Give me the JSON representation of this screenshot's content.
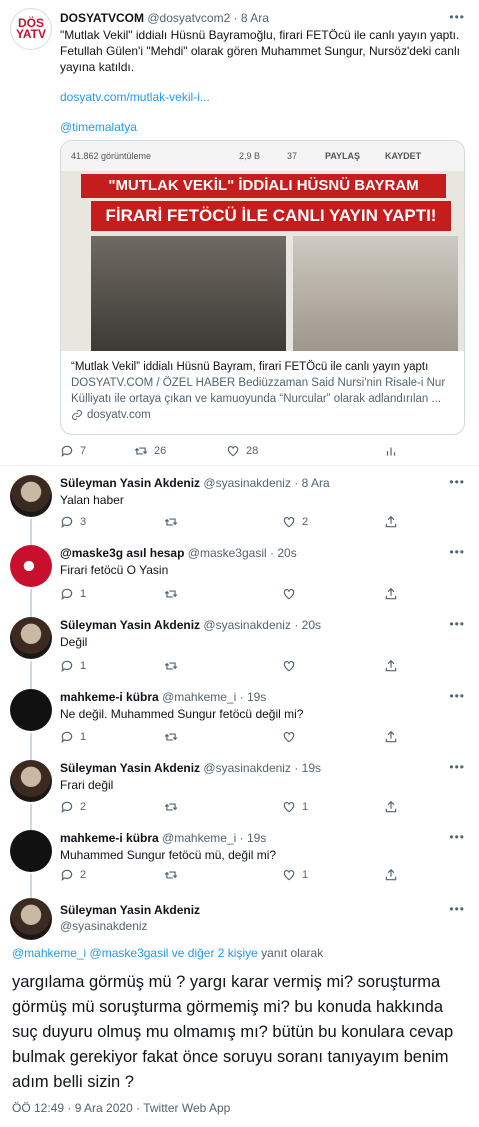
{
  "main_tweet": {
    "avatar_text": [
      "DÖS",
      "YATV"
    ],
    "name": "DOSYATVCOM",
    "handle": "@dosyatvcom2",
    "date": "· 8 Ara",
    "text": "\"Mutlak Vekil\" iddialı Hüsnü Bayramoğlu, firari FETÖcü ile canlı yayın yaptı. Fetullah Gülen'i \"Mehdi\" olarak gören Muhammet Sungur, Nursöz'deki canlı yayına katıldı.",
    "link": "dosyatv.com/mutlak-vekil-i...",
    "mention": "@timemalatya",
    "card": {
      "views": "41.862 görüntüleme",
      "likes": "2,9 B",
      "dislikes": "37",
      "share": "PAYLAŞ",
      "save": "KAYDET",
      "banner1": "\"MUTLAK VEKİL\" İDDİALI HÜSNÜ BAYRAM",
      "banner2": "FİRARİ FETÖCÜ İLE CANLI YAYIN YAPTI!",
      "title": "“Mutlak Vekil” iddialı Hüsnü Bayram, firari FETÖcü ile canlı yayın yaptı",
      "description": "DOSYATV.COM / ÖZEL HABER Bediüzzaman Said Nursi'nin Risale-i Nur Külliyatı ile ortaya çıkan ve kamuoyunda “Nurcular” olarak adlandırılan ...",
      "domain": "dosyatv.com"
    },
    "replies": "7",
    "retweets": "26",
    "likes": "28"
  },
  "replies": [
    {
      "name": "Süleyman Yasin Akdeniz",
      "handle": "@syasinakdeniz",
      "date": "· 8 Ara",
      "text": "Yalan haber",
      "replies": "3",
      "retweets": "",
      "likes": "2"
    },
    {
      "name": "@maske3g asıl hesap",
      "handle": "@maske3gasil",
      "date": "· 20s",
      "text": "Firari fetöcü O Yasin",
      "replies": "1",
      "retweets": "",
      "likes": ""
    },
    {
      "name": "Süleyman Yasin Akdeniz",
      "handle": "@syasinakdeniz",
      "date": "· 20s",
      "text": "Değil",
      "replies": "1",
      "retweets": "",
      "likes": ""
    },
    {
      "name": "mahkeme-i kübra",
      "handle": "@mahkeme_i",
      "date": "· 19s",
      "text": "Ne değil. Muhammed Sungur fetöcü değil mi?",
      "replies": "1",
      "retweets": "",
      "likes": ""
    },
    {
      "name": "Süleyman Yasin Akdeniz",
      "handle": "@syasinakdeniz",
      "date": "· 19s",
      "text": "Frari değil",
      "replies": "2",
      "retweets": "",
      "likes": "1"
    },
    {
      "name": "mahkeme-i kübra",
      "handle": "@mahkeme_i",
      "date": "· 19s",
      "text": "Muhammed Sungur fetöcü mü, değil mi?",
      "replies": "2",
      "retweets": "",
      "likes": "1"
    }
  ],
  "focused": {
    "name": "Süleyman Yasin Akdeniz",
    "handle": "@syasinakdeniz",
    "reply_mentions": "@mahkeme_i @maske3gasil",
    "reply_others": "ve diğer 2 kişiye",
    "reply_suffix": "yanıt olarak",
    "text": "yargılama görmüş mü ? yargı karar vermiş mi? soruşturma görmüş mü soruşturma görmemiş mi? bu konuda hakkında suç duyuru olmuş mu olmamış mı? bütün bu konulara cevap bulmak gerekiyor fakat önce soruyu soranı tanıyayım benim adım belli sizin ?",
    "footer": "ÖÖ 12:49 · 9 Ara 2020 · Twitter Web App"
  },
  "more_glyph": "•••",
  "colors": {
    "link": "#1d9bf0",
    "secondary": "#536471",
    "divider": "#e6ecf0",
    "banner": "#c51d1d"
  }
}
